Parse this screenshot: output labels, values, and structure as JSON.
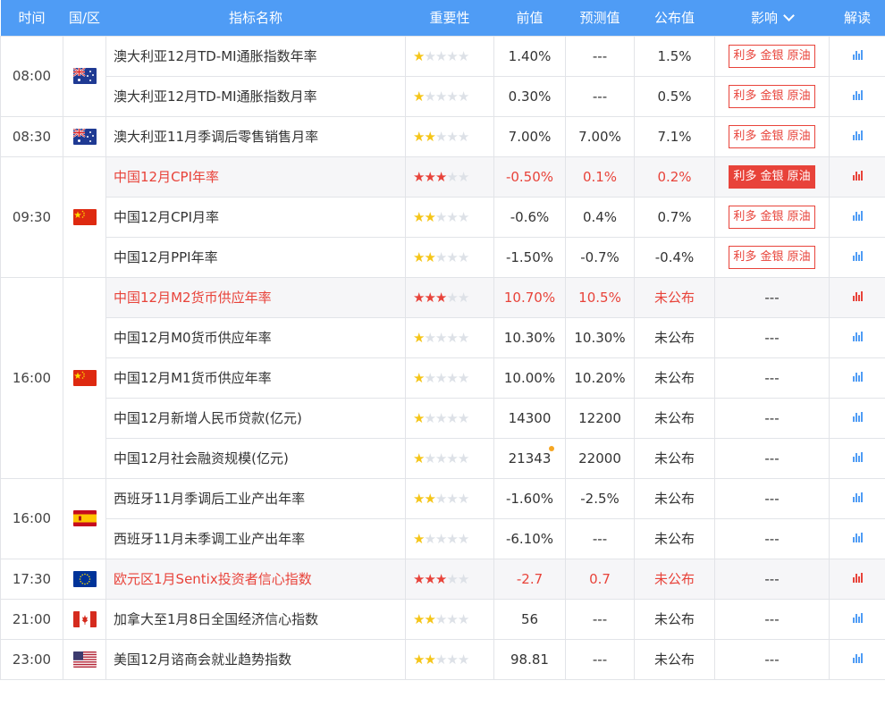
{
  "header": {
    "time": "时间",
    "region": "国/区",
    "indicator": "指标名称",
    "importance": "重要性",
    "previous": "前值",
    "forecast": "预测值",
    "actual": "公布值",
    "impact": "影响",
    "interpret": "解读"
  },
  "colors": {
    "header_bg": "#4f9cf5",
    "accent_red": "#e8433a",
    "star_yellow": "#f5c518"
  },
  "groups": [
    {
      "time": "08:00",
      "flag": "australia-flag",
      "rows": [
        {
          "name": "澳大利亚12月TD-MI通胀指数年率",
          "stars": 1,
          "prev": "1.40%",
          "forecast": "---",
          "actual": "1.5%",
          "impact": "利多 金银 原油",
          "impact_style": "outline",
          "highlight": false
        },
        {
          "name": "澳大利亚12月TD-MI通胀指数月率",
          "stars": 1,
          "prev": "0.30%",
          "forecast": "---",
          "actual": "0.5%",
          "impact": "利多 金银 原油",
          "impact_style": "outline",
          "highlight": false
        }
      ]
    },
    {
      "time": "08:30",
      "flag": "australia-flag",
      "rows": [
        {
          "name": "澳大利亚11月季调后零售销售月率",
          "stars": 2,
          "prev": "7.00%",
          "forecast": "7.00%",
          "actual": "7.1%",
          "impact": "利多 金银 原油",
          "impact_style": "outline",
          "highlight": false
        }
      ]
    },
    {
      "time": "09:30",
      "flag": "china-flag",
      "rows": [
        {
          "name": "中国12月CPI年率",
          "stars": 3,
          "prev": "-0.50%",
          "forecast": "0.1%",
          "actual": "0.2%",
          "impact": "利多 金银 原油",
          "impact_style": "solid",
          "highlight": true
        },
        {
          "name": "中国12月CPI月率",
          "stars": 2,
          "prev": "-0.6%",
          "forecast": "0.4%",
          "actual": "0.7%",
          "impact": "利多 金银 原油",
          "impact_style": "outline",
          "highlight": false
        },
        {
          "name": "中国12月PPI年率",
          "stars": 2,
          "prev": "-1.50%",
          "forecast": "-0.7%",
          "actual": "-0.4%",
          "impact": "利多 金银 原油",
          "impact_style": "outline",
          "highlight": false
        }
      ]
    },
    {
      "time": "16:00",
      "flag": "china-flag",
      "rows": [
        {
          "name": "中国12月M2货币供应年率",
          "stars": 3,
          "prev": "10.70%",
          "forecast": "10.5%",
          "actual": "未公布",
          "impact": "---",
          "impact_style": "none",
          "highlight": true
        },
        {
          "name": "中国12月M0货币供应年率",
          "stars": 1,
          "prev": "10.30%",
          "forecast": "10.30%",
          "actual": "未公布",
          "impact": "---",
          "impact_style": "none",
          "highlight": false
        },
        {
          "name": "中国12月M1货币供应年率",
          "stars": 1,
          "prev": "10.00%",
          "forecast": "10.20%",
          "actual": "未公布",
          "impact": "---",
          "impact_style": "none",
          "highlight": false
        },
        {
          "name": "中国12月新增人民币贷款(亿元)",
          "stars": 1,
          "prev": "14300",
          "forecast": "12200",
          "actual": "未公布",
          "impact": "---",
          "impact_style": "none",
          "highlight": false
        },
        {
          "name": "中国12月社会融资规模(亿元)",
          "stars": 1,
          "prev": "21343",
          "prev_revised": true,
          "forecast": "22000",
          "actual": "未公布",
          "impact": "---",
          "impact_style": "none",
          "highlight": false
        }
      ]
    },
    {
      "time": "16:00",
      "flag": "spain-flag",
      "rows": [
        {
          "name": "西班牙11月季调后工业产出年率",
          "stars": 2,
          "prev": "-1.60%",
          "forecast": "-2.5%",
          "actual": "未公布",
          "impact": "---",
          "impact_style": "none",
          "highlight": false
        },
        {
          "name": "西班牙11月未季调工业产出年率",
          "stars": 1,
          "prev": "-6.10%",
          "forecast": "---",
          "actual": "未公布",
          "impact": "---",
          "impact_style": "none",
          "highlight": false
        }
      ]
    },
    {
      "time": "17:30",
      "flag": "eu-flag",
      "rows": [
        {
          "name": "欧元区1月Sentix投资者信心指数",
          "stars": 3,
          "prev": "-2.7",
          "forecast": "0.7",
          "actual": "未公布",
          "impact": "---",
          "impact_style": "none",
          "highlight": true
        }
      ]
    },
    {
      "time": "21:00",
      "flag": "canada-flag",
      "rows": [
        {
          "name": "加拿大至1月8日全国经济信心指数",
          "stars": 2,
          "prev": "56",
          "forecast": "---",
          "actual": "未公布",
          "impact": "---",
          "impact_style": "none",
          "highlight": false
        }
      ]
    },
    {
      "time": "23:00",
      "flag": "usa-flag",
      "rows": [
        {
          "name": "美国12月谘商会就业趋势指数",
          "stars": 2,
          "prev": "98.81",
          "forecast": "---",
          "actual": "未公布",
          "impact": "---",
          "impact_style": "none",
          "highlight": false
        }
      ]
    }
  ]
}
